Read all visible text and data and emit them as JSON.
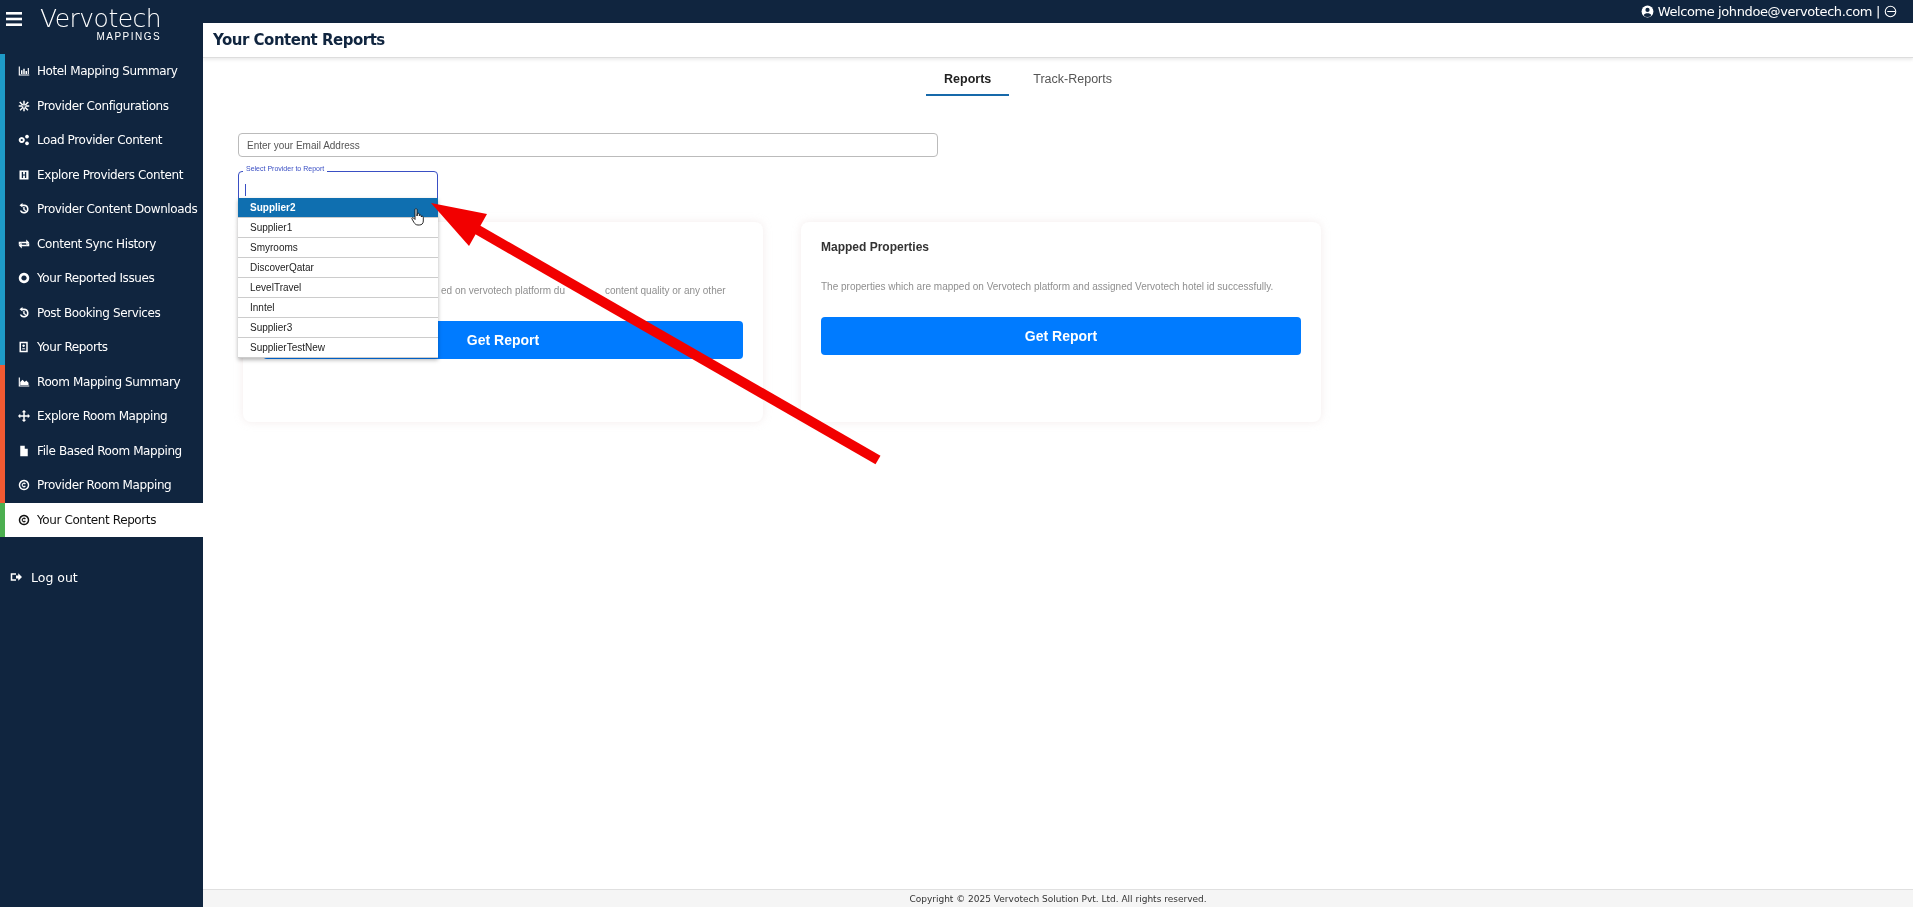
{
  "brand": {
    "name": "Vervotech",
    "subtitle": "MAPPINGS"
  },
  "topbar": {
    "welcome": "Welcome johndoe@vervotech.com",
    "separator": "|"
  },
  "sidebar": {
    "items": [
      {
        "label": "Hotel Mapping Summary",
        "color": "#1e9bc8",
        "selected": false
      },
      {
        "label": "Provider Configurations",
        "color": "#1e9bc8",
        "selected": false
      },
      {
        "label": "Load Provider Content",
        "color": "#1e9bc8",
        "selected": false
      },
      {
        "label": "Explore Providers Content",
        "color": "#1e9bc8",
        "selected": false
      },
      {
        "label": "Provider Content Downloads",
        "color": "#1e9bc8",
        "selected": false
      },
      {
        "label": "Content Sync History",
        "color": "#1e9bc8",
        "selected": false
      },
      {
        "label": "Your Reported Issues",
        "color": "#1e9bc8",
        "selected": false
      },
      {
        "label": "Post Booking Services",
        "color": "#1e9bc8",
        "selected": false
      },
      {
        "label": "Your Reports",
        "color": "#1e9bc8",
        "selected": false
      },
      {
        "label": "Room Mapping Summary",
        "color": "#f25a32",
        "selected": false
      },
      {
        "label": "Explore Room Mapping",
        "color": "#f25a32",
        "selected": false
      },
      {
        "label": "File Based Room Mapping",
        "color": "#f25a32",
        "selected": false
      },
      {
        "label": "Provider Room Mapping",
        "color": "#f25a32",
        "selected": false
      },
      {
        "label": "Your Content Reports",
        "color": "#4caf50",
        "selected": true
      }
    ],
    "logout": "Log out"
  },
  "page": {
    "title": "Your Content Reports"
  },
  "tabs": [
    {
      "label": "Reports",
      "selected": true
    },
    {
      "label": "Track-Reports",
      "selected": false
    }
  ],
  "email": {
    "placeholder": "Enter your Email Address"
  },
  "provider_select": {
    "label": "Select Provider to Report",
    "options": [
      {
        "label": "Supplier2",
        "selected": true
      },
      {
        "label": "Supplier1",
        "selected": false
      },
      {
        "label": "Smyrooms",
        "selected": false
      },
      {
        "label": "DiscoverQatar",
        "selected": false
      },
      {
        "label": "LevelTravel",
        "selected": false
      },
      {
        "label": "Inntel",
        "selected": false
      },
      {
        "label": "Supplier3",
        "selected": false
      },
      {
        "label": "SupplierTestNew",
        "selected": false
      }
    ]
  },
  "cards": [
    {
      "description": [
        "ed on vervotech platform du",
        "content quality or any other"
      ],
      "button": "Get Report"
    },
    {
      "title": "Mapped Properties",
      "description": [
        "The properties which are mapped on Vervotech platform and assigned Vervotech hotel id successfully."
      ],
      "button": "Get Report"
    }
  ],
  "footer": "Copyright © 2025 Vervotech Solution Pvt. Ltd. All rights reserved."
}
